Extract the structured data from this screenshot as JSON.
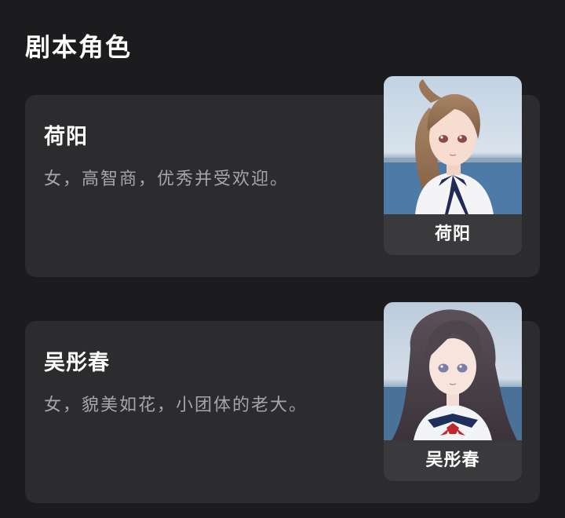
{
  "section": {
    "title": "剧本角色"
  },
  "characters": [
    {
      "name": "荷阳",
      "description": "女，高智商，优秀并受欢迎。",
      "avatar_label": "荷阳",
      "avatar_icon": "girl-brown-ponytail-avatar"
    },
    {
      "name": "吴彤春",
      "description": "女，貌美如花，小团体的老大。",
      "avatar_label": "吴彤春",
      "avatar_icon": "girl-long-dark-hair-avatar"
    }
  ],
  "colors": {
    "background": "#1c1c1e",
    "card": "#2c2c2e",
    "avatar_label_bg": "#3a3a3c",
    "text_primary": "#ffffff",
    "text_secondary": "#a6a6aa"
  }
}
